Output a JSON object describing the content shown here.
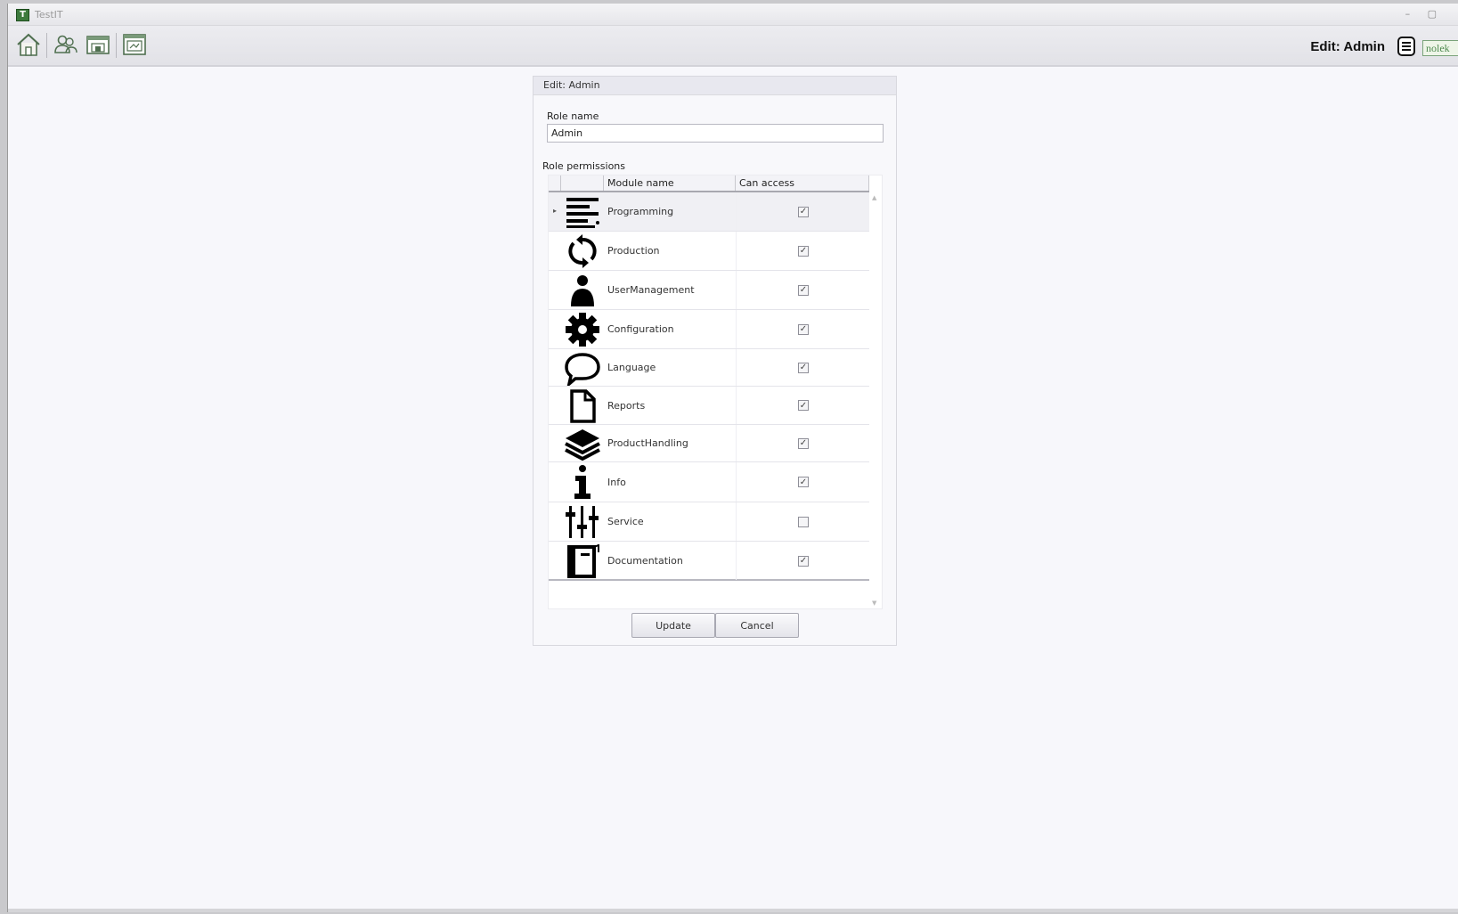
{
  "window": {
    "title": "TestIT",
    "controls": "– ▢"
  },
  "toolbar": {
    "title": "Edit: Admin",
    "buttons": [
      "home-icon",
      "users-icon",
      "window-icon",
      "screen-icon"
    ],
    "logo_text": "nolek"
  },
  "panel": {
    "header": "Edit: Admin",
    "role_name_label": "Role name",
    "role_name_value": "Admin",
    "permissions_label": "Role permissions",
    "columns": {
      "module": "Module name",
      "access": "Can access"
    },
    "modules": [
      {
        "name": "Programming",
        "icon": "programming-icon",
        "can_access": true
      },
      {
        "name": "Production",
        "icon": "refresh-icon",
        "can_access": true
      },
      {
        "name": "UserManagement",
        "icon": "user-icon",
        "can_access": true
      },
      {
        "name": "Configuration",
        "icon": "gear-icon",
        "can_access": true
      },
      {
        "name": "Language",
        "icon": "speech-bubble-icon",
        "can_access": true
      },
      {
        "name": "Reports",
        "icon": "document-icon",
        "can_access": true
      },
      {
        "name": "ProductHandling",
        "icon": "layers-icon",
        "can_access": true
      },
      {
        "name": "Info",
        "icon": "info-icon",
        "can_access": true
      },
      {
        "name": "Service",
        "icon": "sliders-icon",
        "can_access": false
      },
      {
        "name": "Documentation",
        "icon": "book-icon",
        "can_access": true
      }
    ],
    "update_label": "Update",
    "cancel_label": "Cancel"
  },
  "colors": {
    "accent": "#3d7a3d",
    "background": "#f7f7fb",
    "panel_header": "#e8e8ef"
  }
}
